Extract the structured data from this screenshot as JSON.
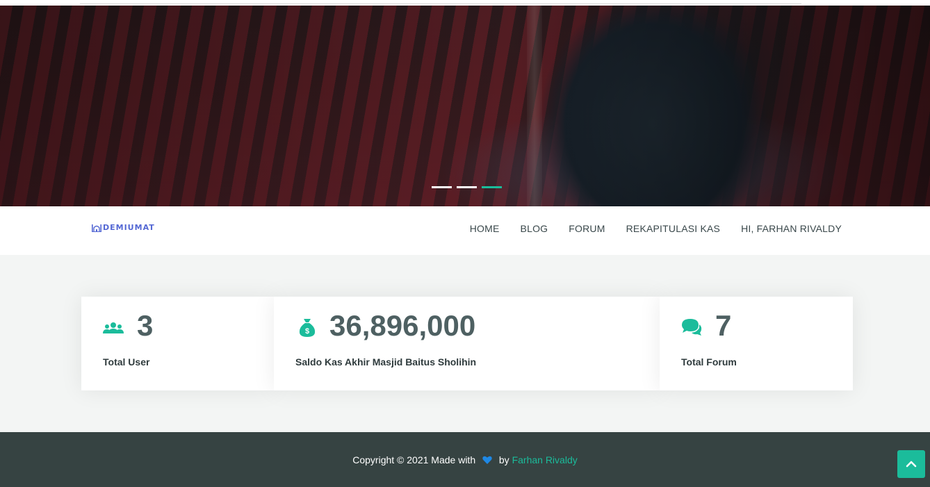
{
  "brand": {
    "logo_text": "DEMIUMAT",
    "accent": "#1bbc9b",
    "logo_color": "#5468d4"
  },
  "hero": {
    "slides": 3,
    "active_slide": 3
  },
  "nav": {
    "items": [
      {
        "label": "HOME"
      },
      {
        "label": "BLOG"
      },
      {
        "label": "FORUM"
      },
      {
        "label": "REKAPITULASI KAS"
      },
      {
        "label": "HI, FARHAN RIVALDY"
      }
    ]
  },
  "stats": [
    {
      "icon": "users-icon",
      "value": "3",
      "label": "Total User"
    },
    {
      "icon": "money-bag-icon",
      "value": "36,896,000",
      "label": "Saldo Kas Akhir Masjid Baitus Sholihin"
    },
    {
      "icon": "comments-icon",
      "value": "7",
      "label": "Total Forum"
    }
  ],
  "footer": {
    "copyright_prefix": "Copyright © 2021 Made with",
    "by": "by",
    "author": "Farhan Rivaldy",
    "heart_color": "#1e88e5",
    "background": "#364342"
  },
  "back_to_top": {
    "icon": "chevron-up-icon"
  }
}
